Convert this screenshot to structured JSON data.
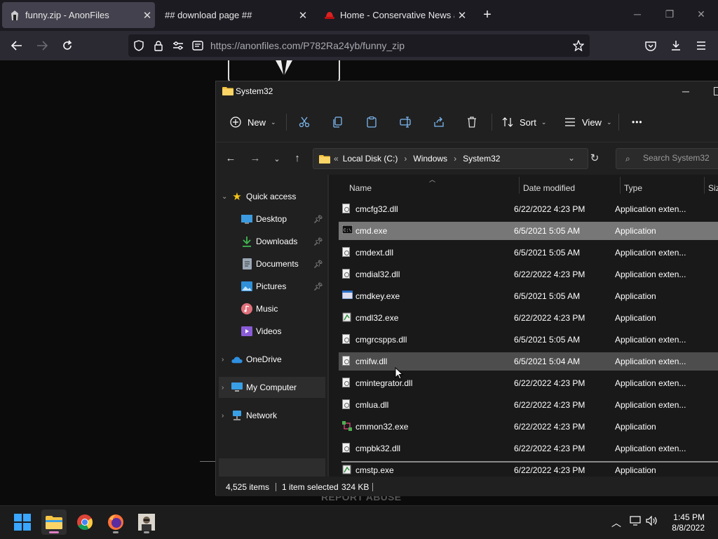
{
  "browser": {
    "tabs": [
      {
        "title": "funny.zip - AnonFiles",
        "active": true,
        "favicon": "anonfiles-icon"
      },
      {
        "title": "## download page ##",
        "active": false,
        "favicon": ""
      },
      {
        "title": "Home - Conservative News and",
        "active": false,
        "favicon": "red-hat-icon"
      }
    ],
    "url_host": "https://anonfiles.com",
    "url_path": "/P782Ra24yb/funny_zip"
  },
  "webpage": {
    "report_abuse": "REPORT ABUSE"
  },
  "explorer": {
    "title": "System32",
    "toolbar": {
      "new_label": "New",
      "sort_label": "Sort",
      "view_label": "View",
      "more_label": "•••"
    },
    "breadcrumbs": [
      "Local Disk (C:)",
      "Windows",
      "System32"
    ],
    "search_placeholder": "Search System32",
    "nav": [
      {
        "label": "Quick access",
        "icon": "star-icon"
      },
      {
        "label": "Desktop",
        "icon": "desktop-icon",
        "pinned": true
      },
      {
        "label": "Downloads",
        "icon": "download-icon",
        "pinned": true
      },
      {
        "label": "Documents",
        "icon": "documents-icon",
        "pinned": true
      },
      {
        "label": "Pictures",
        "icon": "pictures-icon",
        "pinned": true
      },
      {
        "label": "Music",
        "icon": "music-icon"
      },
      {
        "label": "Videos",
        "icon": "videos-icon"
      },
      {
        "label": "OneDrive",
        "icon": "cloud-icon"
      },
      {
        "label": "My Computer",
        "icon": "computer-icon"
      },
      {
        "label": "Network",
        "icon": "network-icon"
      }
    ],
    "columns": {
      "name": "Name",
      "date": "Date modified",
      "type": "Type",
      "size": "Siz"
    },
    "files": [
      {
        "name": "cmcfg32.dll",
        "date": "6/22/2022 4:23 PM",
        "type": "Application exten..."
      },
      {
        "name": "cmd.exe",
        "date": "6/5/2021 5:05 AM",
        "type": "Application",
        "state": "selected"
      },
      {
        "name": "cmdext.dll",
        "date": "6/5/2021 5:05 AM",
        "type": "Application exten..."
      },
      {
        "name": "cmdial32.dll",
        "date": "6/22/2022 4:23 PM",
        "type": "Application exten..."
      },
      {
        "name": "cmdkey.exe",
        "date": "6/5/2021 5:05 AM",
        "type": "Application"
      },
      {
        "name": "cmdl32.exe",
        "date": "6/22/2022 4:23 PM",
        "type": "Application"
      },
      {
        "name": "cmgrcspps.dll",
        "date": "6/5/2021 5:05 AM",
        "type": "Application exten..."
      },
      {
        "name": "cmifw.dll",
        "date": "6/5/2021 5:04 AM",
        "type": "Application exten...",
        "state": "hover"
      },
      {
        "name": "cmintegrator.dll",
        "date": "6/22/2022 4:23 PM",
        "type": "Application exten..."
      },
      {
        "name": "cmlua.dll",
        "date": "6/22/2022 4:23 PM",
        "type": "Application exten..."
      },
      {
        "name": "cmmon32.exe",
        "date": "6/22/2022 4:23 PM",
        "type": "Application"
      },
      {
        "name": "cmpbk32.dll",
        "date": "6/22/2022 4:23 PM",
        "type": "Application exten..."
      },
      {
        "name": "cmstp.exe",
        "date": "6/22/2022 4:23 PM",
        "type": "Application"
      }
    ],
    "status": {
      "items": "4,525 items",
      "selected": "1 item selected",
      "size": "324 KB"
    }
  },
  "taskbar": {
    "time": "1:45 PM",
    "date": "8/8/2022"
  }
}
